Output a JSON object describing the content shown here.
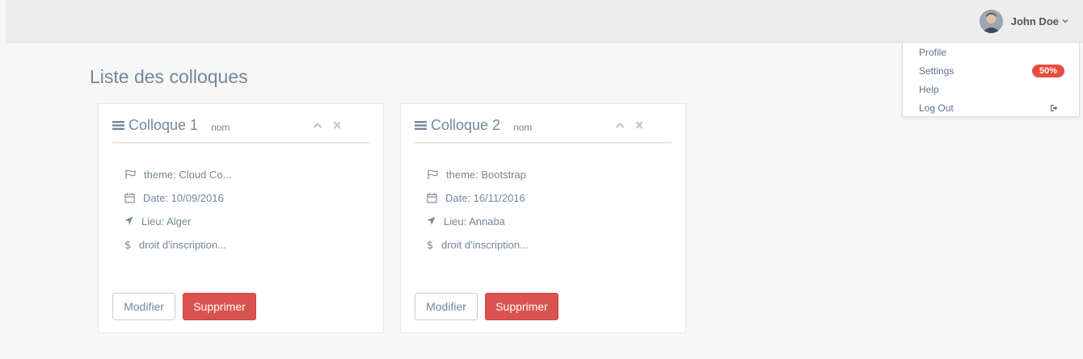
{
  "user": {
    "name": "John Doe"
  },
  "menu": {
    "items": [
      {
        "label": "Profile"
      },
      {
        "label": "Settings",
        "badge": "50%"
      },
      {
        "label": "Help"
      },
      {
        "label": "Log Out"
      }
    ]
  },
  "page": {
    "title": "Liste des colloques"
  },
  "colloques": [
    {
      "title": "Colloque 1",
      "subtitle": "nom",
      "theme": "theme: Cloud Co...",
      "date": "Date: 10/09/2016",
      "lieu": "Lieu: Alger",
      "droit": "droit d'inscription..."
    },
    {
      "title": "Colloque 2",
      "subtitle": "nom",
      "theme": "theme: Bootstrap",
      "date": "Date: 16/11/2016",
      "lieu": "Lieu: Annaba",
      "droit": "droit d'inscription..."
    }
  ],
  "buttons": {
    "modify": "Modifier",
    "delete": "Supprimer"
  },
  "colors": {
    "danger": "#d9534f",
    "badge": "#e74c3c",
    "text": "#73879c"
  }
}
